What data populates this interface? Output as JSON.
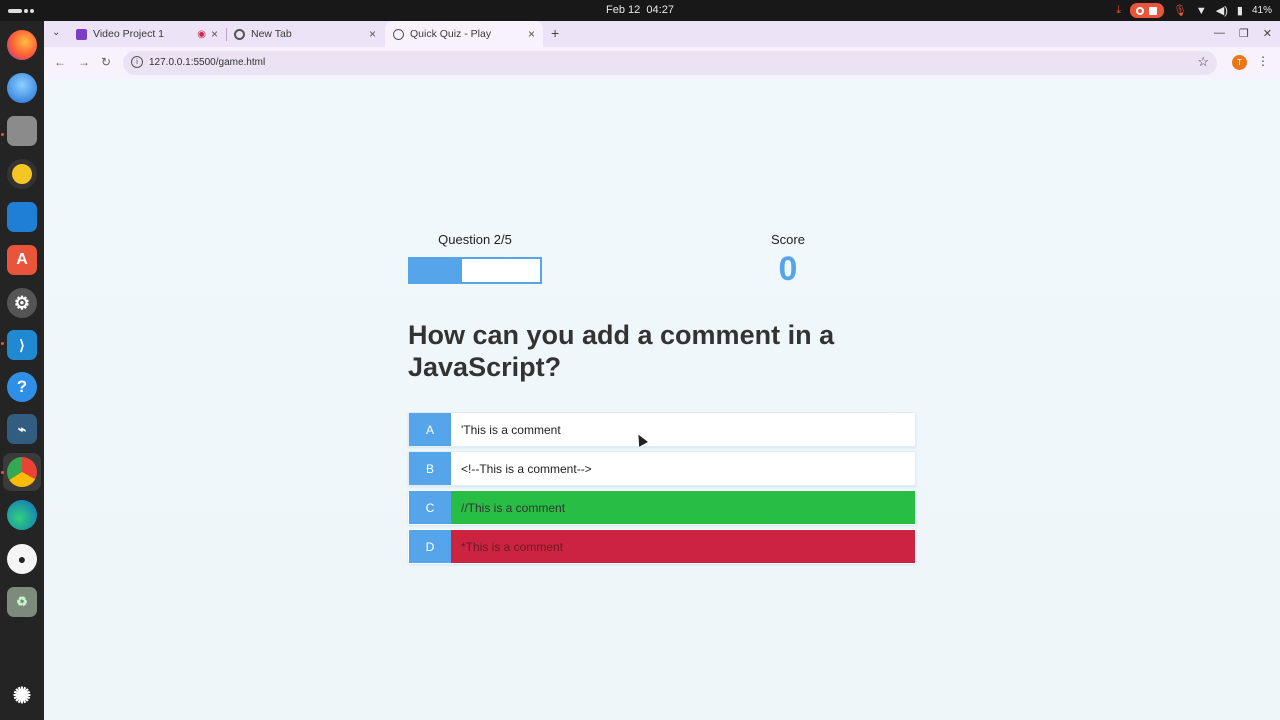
{
  "system": {
    "date": "Feb 12",
    "time": "04:27",
    "battery": "41%"
  },
  "dock": {
    "apps": [
      "firefox-icon",
      "thunderbird-icon",
      "files-icon",
      "rhythmbox-icon",
      "writer-icon",
      "app-center-icon",
      "settings-icon",
      "vscode-icon",
      "help-icon",
      "mysql-workbench-icon",
      "chrome-icon",
      "edge-icon",
      "github-icon",
      "trash-icon",
      "ubuntu-icon"
    ]
  },
  "browser": {
    "tabs": [
      {
        "title": "Video Project 1"
      },
      {
        "title": "New Tab"
      },
      {
        "title": "Quick Quiz - Play"
      }
    ],
    "url": "127.0.0.1:5500/game.html",
    "profile_initial": "T"
  },
  "quiz": {
    "question_label": "Question 2/5",
    "progress_fraction": 0.4,
    "score_label": "Score",
    "score": "0",
    "question": "How can you add a comment in a JavaScript?",
    "choices": [
      {
        "prefix": "A",
        "text": "'This is a comment",
        "state": "normal"
      },
      {
        "prefix": "B",
        "text": "<!--This is a comment-->",
        "state": "normal"
      },
      {
        "prefix": "C",
        "text": "//This is a comment",
        "state": "correct"
      },
      {
        "prefix": "D",
        "text": "*This is a comment",
        "state": "incorrect"
      }
    ],
    "colors": {
      "accent": "#56a5eb",
      "correct": "#28be46",
      "incorrect": "#cc2440"
    }
  }
}
